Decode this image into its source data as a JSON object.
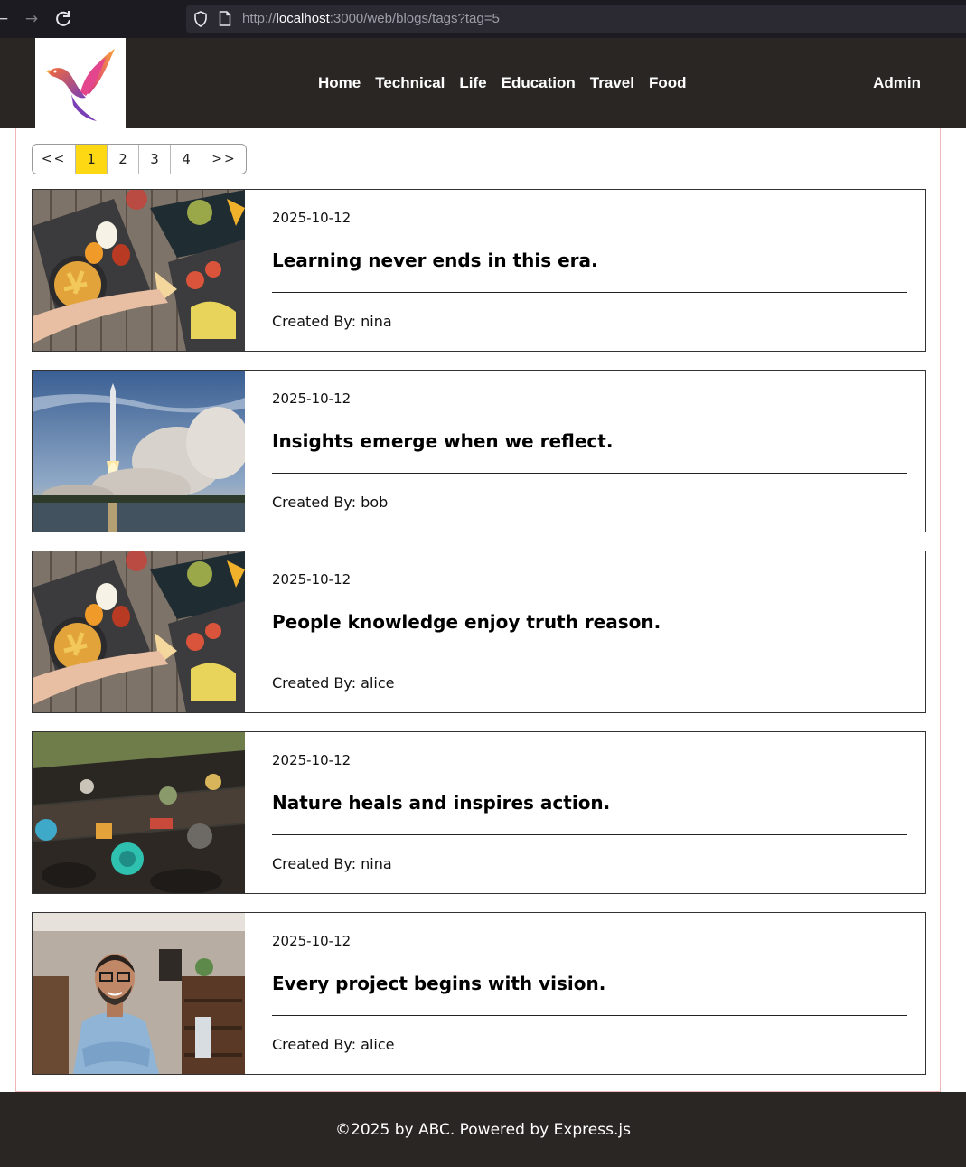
{
  "browser": {
    "url_scheme": "http://",
    "url_host": "localhost",
    "url_rest": ":3000/web/blogs/tags?tag=5"
  },
  "header": {
    "logo_icon": "bird-logo-icon",
    "nav": [
      {
        "label": "Home"
      },
      {
        "label": "Technical"
      },
      {
        "label": "Life"
      },
      {
        "label": "Education"
      },
      {
        "label": "Travel"
      },
      {
        "label": "Food"
      }
    ],
    "admin_label": "Admin"
  },
  "pagination": {
    "prev_label": "<<",
    "next_label": ">>",
    "pages": [
      "1",
      "2",
      "3",
      "4"
    ],
    "active_page": "1",
    "active_color": "#ffd814"
  },
  "posts": [
    {
      "date": "2025-10-12",
      "title": "Learning never ends in this era.",
      "author": "Created By: nina",
      "image": "food-table-photo"
    },
    {
      "date": "2025-10-12",
      "title": "Insights emerge when we reflect.",
      "author": "Created By: bob",
      "image": "rocket-launch-photo"
    },
    {
      "date": "2025-10-12",
      "title": "People knowledge enjoy truth reason.",
      "author": "Created By: alice",
      "image": "food-table-photo"
    },
    {
      "date": "2025-10-12",
      "title": "Nature heals and inspires action.",
      "author": "Created By: nina",
      "image": "floating-market-photo"
    },
    {
      "date": "2025-10-12",
      "title": "Every project begins with vision.",
      "author": "Created By: alice",
      "image": "smiling-man-photo"
    }
  ],
  "footer": {
    "text": "©2025 by ABC. Powered by Express.js"
  },
  "colors": {
    "header_bg": "#2a2624",
    "footer_bg": "#2a2624",
    "content_border": "#f1b6b6"
  }
}
